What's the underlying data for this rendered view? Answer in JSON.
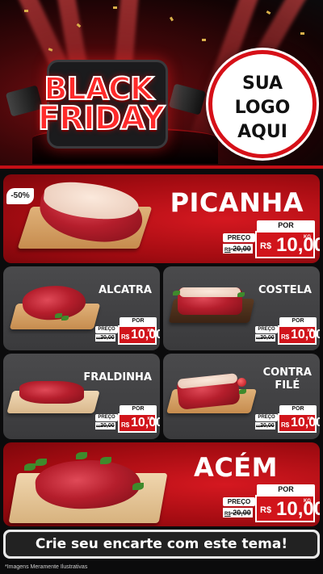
{
  "header": {
    "black_label": "BLACK",
    "friday_label": "FRIDAY",
    "logo_text": "SUA\nLOGO\nAQUI"
  },
  "featured_top": {
    "discount": "-50%",
    "name": "PICANHA",
    "por_label": "POR",
    "preco_label": "PREÇO",
    "old_prefix": "R$",
    "old_price": "20,00",
    "currency": "R$",
    "new_price": "10,00",
    "unit": "KG"
  },
  "products": [
    {
      "name": "ALCATRA",
      "por_label": "POR",
      "preco_label": "PREÇO",
      "old_prefix": "R$",
      "old_price": "20,00",
      "currency": "R$",
      "new_price": "10,00",
      "unit": "KG"
    },
    {
      "name": "COSTELA",
      "por_label": "POR",
      "preco_label": "PREÇO",
      "old_prefix": "R$",
      "old_price": "20,00",
      "currency": "R$",
      "new_price": "10,00",
      "unit": "KG"
    },
    {
      "name": "FRALDINHA",
      "por_label": "POR",
      "preco_label": "PREÇO",
      "old_prefix": "R$",
      "old_price": "20,00",
      "currency": "R$",
      "new_price": "10,00",
      "unit": "KG"
    },
    {
      "name": "CONTRA\nFILÉ",
      "por_label": "POR",
      "preco_label": "PREÇO",
      "old_prefix": "R$",
      "old_price": "20,00",
      "currency": "R$",
      "new_price": "10,00",
      "unit": "KG"
    }
  ],
  "featured_bottom": {
    "name": "ACÉM",
    "por_label": "POR",
    "preco_label": "PREÇO",
    "old_prefix": "R$",
    "old_price": "20,00",
    "currency": "R$",
    "new_price": "10,00",
    "unit": "KG"
  },
  "cta": "Crie seu encarte com este tema!",
  "disclaimer": "*Imagens Meramente Ilustrativas",
  "colors": {
    "accent": "#d1141b",
    "card_gray": "#434345",
    "background": "#0b0b0c"
  }
}
